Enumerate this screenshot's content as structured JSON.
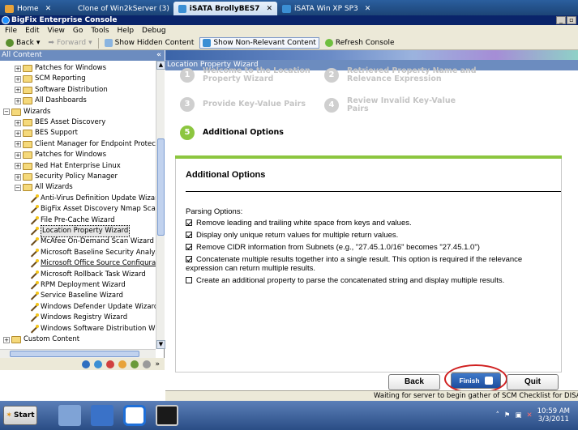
{
  "browser_tabs": [
    {
      "label": "Home",
      "close": "✕",
      "active": false,
      "icon_color": "#e8a33a"
    },
    {
      "label": "Clone of Win2kServer (3)",
      "close": "",
      "active": false,
      "icon_color": "#e8a33a"
    },
    {
      "label": "iSATA BrollyBES7",
      "close": "✕",
      "active": true,
      "icon_color": "#3b8fd4"
    },
    {
      "label": "iSATA Win XP SP3",
      "close": "✕",
      "active": false,
      "icon_color": "#3b8fd4"
    }
  ],
  "window": {
    "title": "BigFix Enterprise Console",
    "min": "_",
    "max": "▫",
    "close": "✕"
  },
  "menu": [
    "File",
    "Edit",
    "View",
    "Go",
    "Tools",
    "Help",
    "Debug"
  ],
  "toolbar": {
    "back": "Back",
    "forward": "Forward",
    "show_hidden": "Show Hidden Content",
    "show_non_relevant": "Show Non-Relevant Content",
    "refresh": "Refresh Console"
  },
  "left_pane": {
    "header": "All Content",
    "collapse_glyph": "«",
    "tree": [
      {
        "label": "Patches for Windows",
        "type": "folder",
        "expander": "+",
        "indent": 1
      },
      {
        "label": "SCM Reporting",
        "type": "folder",
        "expander": "+",
        "indent": 1
      },
      {
        "label": "Software Distribution",
        "type": "folder",
        "expander": "+",
        "indent": 1
      },
      {
        "label": "All Dashboards",
        "type": "folder",
        "expander": "+",
        "indent": 1
      },
      {
        "label": "Wizards",
        "type": "folder",
        "expander": "−",
        "indent": 0
      },
      {
        "label": "BES Asset Discovery",
        "type": "folder",
        "expander": "+",
        "indent": 1
      },
      {
        "label": "BES Support",
        "type": "folder",
        "expander": "+",
        "indent": 1
      },
      {
        "label": "Client Manager for Endpoint Protection",
        "type": "folder",
        "expander": "+",
        "indent": 1
      },
      {
        "label": "Patches for Windows",
        "type": "folder",
        "expander": "+",
        "indent": 1
      },
      {
        "label": "Red Hat Enterprise Linux",
        "type": "folder",
        "expander": "+",
        "indent": 1
      },
      {
        "label": "Security Policy Manager",
        "type": "folder",
        "expander": "+",
        "indent": 1
      },
      {
        "label": "All Wizards",
        "type": "folder",
        "expander": "−",
        "indent": 1
      },
      {
        "label": "Anti-Virus Definition Update Wizard",
        "type": "wizard",
        "indent": 2
      },
      {
        "label": "BigFix Asset Discovery Nmap Scan",
        "type": "wizard",
        "indent": 2
      },
      {
        "label": "File Pre-Cache Wizard",
        "type": "wizard",
        "indent": 2
      },
      {
        "label": "Location Property Wizard",
        "type": "wizard",
        "indent": 2,
        "selected": true
      },
      {
        "label": "McAfee On-Demand Scan Wizard",
        "type": "wizard",
        "indent": 2
      },
      {
        "label": "Microsoft Baseline Security Analyze",
        "type": "wizard",
        "indent": 2
      },
      {
        "label": "Microsoft Office Source Configurati",
        "type": "wizard",
        "indent": 2,
        "underline": true
      },
      {
        "label": "Microsoft Rollback Task Wizard",
        "type": "wizard",
        "indent": 2
      },
      {
        "label": "RPM Deployment Wizard",
        "type": "wizard",
        "indent": 2
      },
      {
        "label": "Service Baseline Wizard",
        "type": "wizard",
        "indent": 2
      },
      {
        "label": "Windows Defender Update Wizard",
        "type": "wizard",
        "indent": 2
      },
      {
        "label": "Windows Registry Wizard",
        "type": "wizard",
        "indent": 2
      },
      {
        "label": "Windows Software Distribution Wiz",
        "type": "wizard",
        "indent": 2
      },
      {
        "label": "Custom Content",
        "type": "folder",
        "expander": "+",
        "indent": 0
      }
    ],
    "bottom_icon_colors": [
      "#2f6fc0",
      "#3b8fd4",
      "#d04040",
      "#e8a33a",
      "#6a9a3a",
      "#9a9a9a"
    ],
    "bottom_more": "»"
  },
  "wizard": {
    "header": "Location Property Wizard",
    "steps": [
      {
        "num": "1",
        "label": "Welcome to the Location Property Wizard"
      },
      {
        "num": "2",
        "label": "Retrieved Property Name and Relevance Expression"
      },
      {
        "num": "3",
        "label": "Provide Key-Value Pairs"
      },
      {
        "num": "4",
        "label": "Review Invalid Key-Value Pairs"
      },
      {
        "num": "5",
        "label": "Additional Options"
      }
    ],
    "section_title": "Additional Options",
    "parsing_label": "Parsing Options:",
    "options": [
      {
        "checked": true,
        "label": "Remove leading and trailing white space from keys and values."
      },
      {
        "checked": true,
        "label": "Display only unique return values for multiple return values."
      },
      {
        "checked": true,
        "label": "Remove CIDR information from Subnets (e.g., \"27.45.1.0/16\" becomes \"27.45.1.0\")"
      },
      {
        "checked": true,
        "label": "Concatenate multiple results together into a single result. This option is required if the relevance expression can return multiple results."
      },
      {
        "checked": false,
        "label": "Create an additional property to parse the concatenated string and display multiple results."
      }
    ],
    "buttons": {
      "back": "Back",
      "finish": "Finish",
      "quit": "Quit"
    }
  },
  "status_text": "Waiting for server to begin gather of SCM Checklist for DISA STIG on W",
  "taskbar": {
    "start": "Start",
    "time": "10:59 AM",
    "date": "3/3/2011"
  },
  "colors": {
    "accent_green": "#8cc63f",
    "header_blue": "#6c8cbf",
    "annotation_red": "#d02020"
  }
}
